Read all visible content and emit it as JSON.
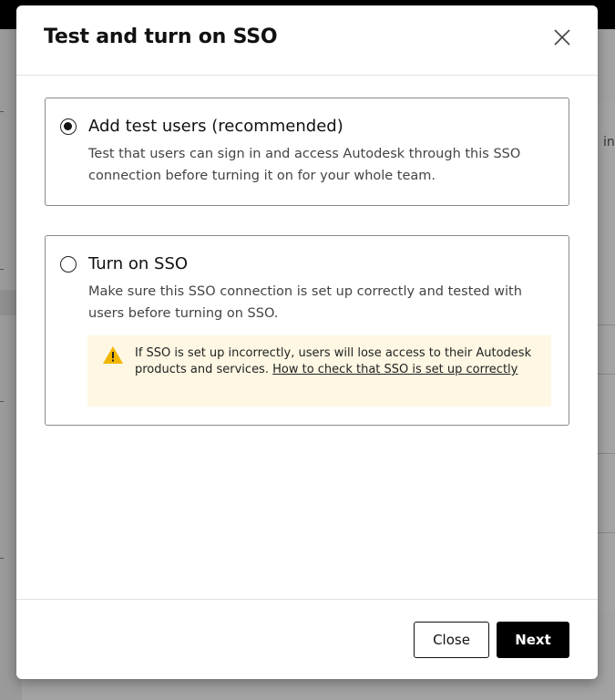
{
  "background": {
    "right_fragment_text": "in"
  },
  "modal": {
    "title": "Test and turn on SSO",
    "close_icon": "close-icon",
    "options": [
      {
        "title": "Add test users (recommended)",
        "description": "Test that users can sign in and access Autodesk through this SSO connection before turning it on for your whole team.",
        "selected": true
      },
      {
        "title": "Turn on SSO",
        "description": "Make sure this SSO connection is set up correctly and tested with users before turning on SSO.",
        "selected": false,
        "warning": {
          "icon": "warning-icon",
          "text": "If SSO is set up incorrectly, users will lose access to their Autodesk products and services.",
          "link_text": "How to check that SSO is set up correctly"
        }
      }
    ],
    "footer": {
      "close_label": "Close",
      "next_label": "Next"
    }
  },
  "colors": {
    "primary_button": "#000000",
    "warning_background": "#fdf7e3",
    "warning_icon": "#f2b600",
    "overlay": "#9a9a9a"
  }
}
